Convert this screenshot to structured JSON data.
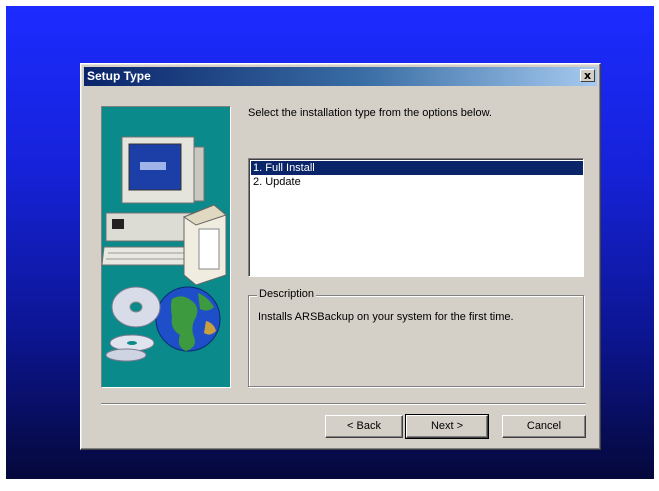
{
  "window": {
    "title": "Setup Type",
    "close_label": "x"
  },
  "instruction": "Select the installation type from the options below.",
  "install_types": [
    {
      "label": "1. Full Install",
      "selected": true
    },
    {
      "label": "2. Update",
      "selected": false
    }
  ],
  "description": {
    "legend": "Description",
    "text": "Installs ARSBackup on your system for the first time."
  },
  "buttons": {
    "back": "< Back",
    "next": "Next >",
    "cancel": "Cancel"
  },
  "colors": {
    "desktop_top": "#1c2bff",
    "desktop_bottom": "#05083a",
    "dialog_bg": "#d4d0c8",
    "title_bar": "#0a246a",
    "selection": "#0a246a",
    "side_panel": "#0a8a8a"
  },
  "icons": [
    "computer-illustration",
    "globe-icon",
    "cd-disc-icon",
    "close-icon"
  ]
}
